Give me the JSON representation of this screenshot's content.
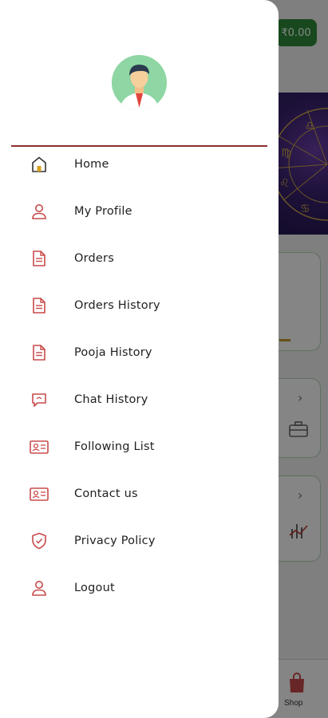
{
  "background": {
    "wallet_balance": "₹0.00",
    "bottom_nav_shop_label": "Shop"
  },
  "drawer": {
    "avatar_icon": "user-avatar-icon",
    "menu": [
      {
        "label": "Home",
        "icon": "home-icon"
      },
      {
        "label": "My Profile",
        "icon": "user-icon"
      },
      {
        "label": "Orders",
        "icon": "document-icon"
      },
      {
        "label": "Orders History",
        "icon": "document-icon"
      },
      {
        "label": "Pooja History",
        "icon": "document-icon"
      },
      {
        "label": "Chat History",
        "icon": "chat-icon"
      },
      {
        "label": "Following List",
        "icon": "id-card-icon"
      },
      {
        "label": "Contact us",
        "icon": "contact-card-icon"
      },
      {
        "label": "Privacy Policy",
        "icon": "shield-icon"
      },
      {
        "label": "Logout",
        "icon": "user-icon"
      }
    ]
  },
  "colors": {
    "accent_red": "#c94a4a",
    "divider": "#8a2f2f",
    "home_icon_yellow": "#d9a21b",
    "wallet_green": "#2e8b3a"
  }
}
